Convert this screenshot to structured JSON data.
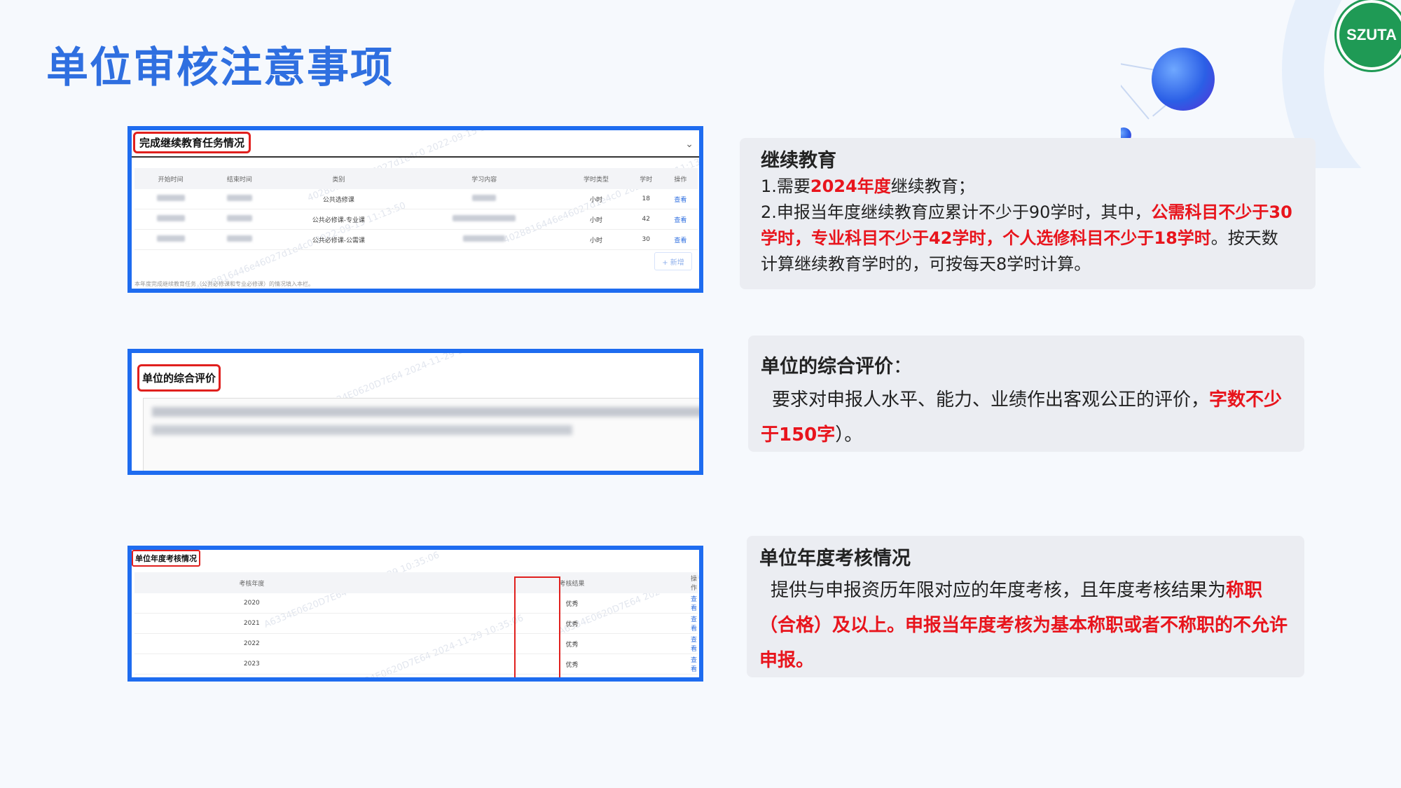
{
  "page": {
    "title": "单位审核注意事项",
    "logo_text": "SZUTA"
  },
  "colors": {
    "title": "#2f6fe0",
    "accent_red": "#e8141c",
    "frame_blue": "#1e6cf0"
  },
  "sections": [
    {
      "screenshot": {
        "label": "完成继续教育任务情况",
        "columns": [
          "开始时间",
          "结束时间",
          "类别",
          "学习内容",
          "学时类型",
          "学时",
          "操作"
        ],
        "rows": [
          {
            "category": "公共选修课",
            "type": "小时",
            "hours": "18",
            "action": "查看"
          },
          {
            "category": "公共必修课-专业课",
            "type": "小时",
            "hours": "42",
            "action": "查看"
          },
          {
            "category": "公共必修课-公需课",
            "type": "小时",
            "hours": "30",
            "action": "查看"
          }
        ],
        "add_button": "+ 新增",
        "footnote": "本年度完成继续教育任务（公共必修课和专业必修课）的情况填入本栏。"
      },
      "card": {
        "heading": "继续教育",
        "line1_prefix": "1.需要",
        "line1_highlight": "2024年度",
        "line1_suffix": "继续教育；",
        "line2_prefix": "2.申报当年度继续教育应累计不少于90学时，其中，",
        "line2_highlight": "公需科目不少于30学时，专业科目不少于42学时，个人选修科目不少于18学时",
        "line2_suffix": "。按天数计算继续教育学时的，可按每天8学时计算。"
      }
    },
    {
      "screenshot": {
        "label": "单位的综合评价"
      },
      "card": {
        "heading": "单位的综合评价",
        "heading_suffix": "：",
        "body_prefix": "要求对申报人水平、能力、业绩作出客观公正的评价，",
        "body_highlight": "字数不少于150字",
        "body_suffix": "）。"
      }
    },
    {
      "screenshot": {
        "label": "单位年度考核情况",
        "columns": [
          "考核年度",
          "考核结果",
          "操作"
        ],
        "rows": [
          {
            "year": "2020",
            "result": "优秀",
            "action": "查看"
          },
          {
            "year": "2021",
            "result": "优秀",
            "action": "查看"
          },
          {
            "year": "2022",
            "result": "优秀",
            "action": "查看"
          },
          {
            "year": "2023",
            "result": "优秀",
            "action": "查看"
          }
        ]
      },
      "card": {
        "heading": "单位年度考核情况",
        "body_prefix": "提供与申报资历年限对应的年度考核，且年度考核结果为",
        "body_highlight": "称职（合格）及以上。申报当年度考核为基本称职或者不称职的不允许申报。"
      }
    }
  ]
}
